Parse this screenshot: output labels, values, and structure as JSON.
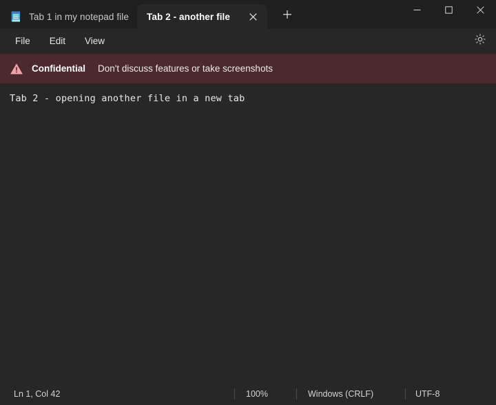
{
  "window": {
    "background_color": "#272727",
    "titlebar_color": "#1f1f1f"
  },
  "titlebar": {
    "tabs": [
      {
        "label": "Tab 1 in my notepad file",
        "active": false,
        "icon": "notepad-icon"
      },
      {
        "label": "Tab 2 - another file",
        "active": true,
        "close_icon": "close-icon"
      }
    ],
    "new_tab_label": "+",
    "new_tab_icon": "plus-icon",
    "controls": {
      "minimize_icon": "minimize-icon",
      "maximize_icon": "maximize-icon",
      "close_icon": "close-icon"
    }
  },
  "menubar": {
    "items": [
      {
        "label": "File"
      },
      {
        "label": "Edit"
      },
      {
        "label": "View"
      }
    ],
    "settings_icon": "gear-icon"
  },
  "banner": {
    "icon": "warning-triangle-icon",
    "title": "Confidential",
    "message": "Don't discuss features or take screenshots",
    "background_color": "#4a2a2c",
    "icon_color": "#f5a3ad"
  },
  "editor": {
    "content": "Tab 2 - opening another file in a new tab"
  },
  "statusbar": {
    "cursor": "Ln 1, Col 42",
    "zoom": "100%",
    "line_ending": "Windows (CRLF)",
    "encoding": "UTF-8"
  }
}
